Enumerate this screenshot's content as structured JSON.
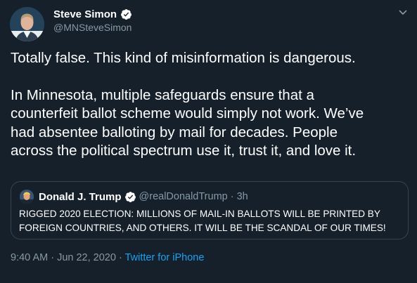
{
  "author": {
    "display_name": "Steve Simon",
    "handle": "@MNSteveSimon",
    "avatar": "author-avatar-photo",
    "verified_icon": "verified-badge-icon"
  },
  "menu_icon": "chevron-down-icon",
  "tweet": {
    "lines": [
      "Totally false. This kind of misinformation is dangerous.",
      "In Minnesota, multiple safeguards ensure that a",
      "counterfeit ballot scheme would simply not work. We’ve",
      "had absentee balloting by mail for decades. People",
      "across the political spectrum use it, trust it, and love it."
    ]
  },
  "quoted_tweet": {
    "display_name": "Donald J. Trump",
    "handle": "@realDonaldTrump",
    "separator": "·",
    "time": "3h",
    "lines": [
      "RIGGED 2020 ELECTION: MILLIONS OF MAIL-IN BALLOTS WILL BE PRINTED BY",
      "FOREIGN COUNTRIES, AND OTHERS. IT WILL BE THE SCANDAL OF OUR TIMES!"
    ]
  },
  "meta": {
    "timestamp": "9:40 AM · Jun 22, 2020 · ",
    "source": "Twitter for iPhone"
  },
  "colors": {
    "background": "#15202b",
    "text": "#ffffff",
    "secondary_text": "#8899a6",
    "accent": "#1da1f2",
    "border": "#38444d"
  }
}
